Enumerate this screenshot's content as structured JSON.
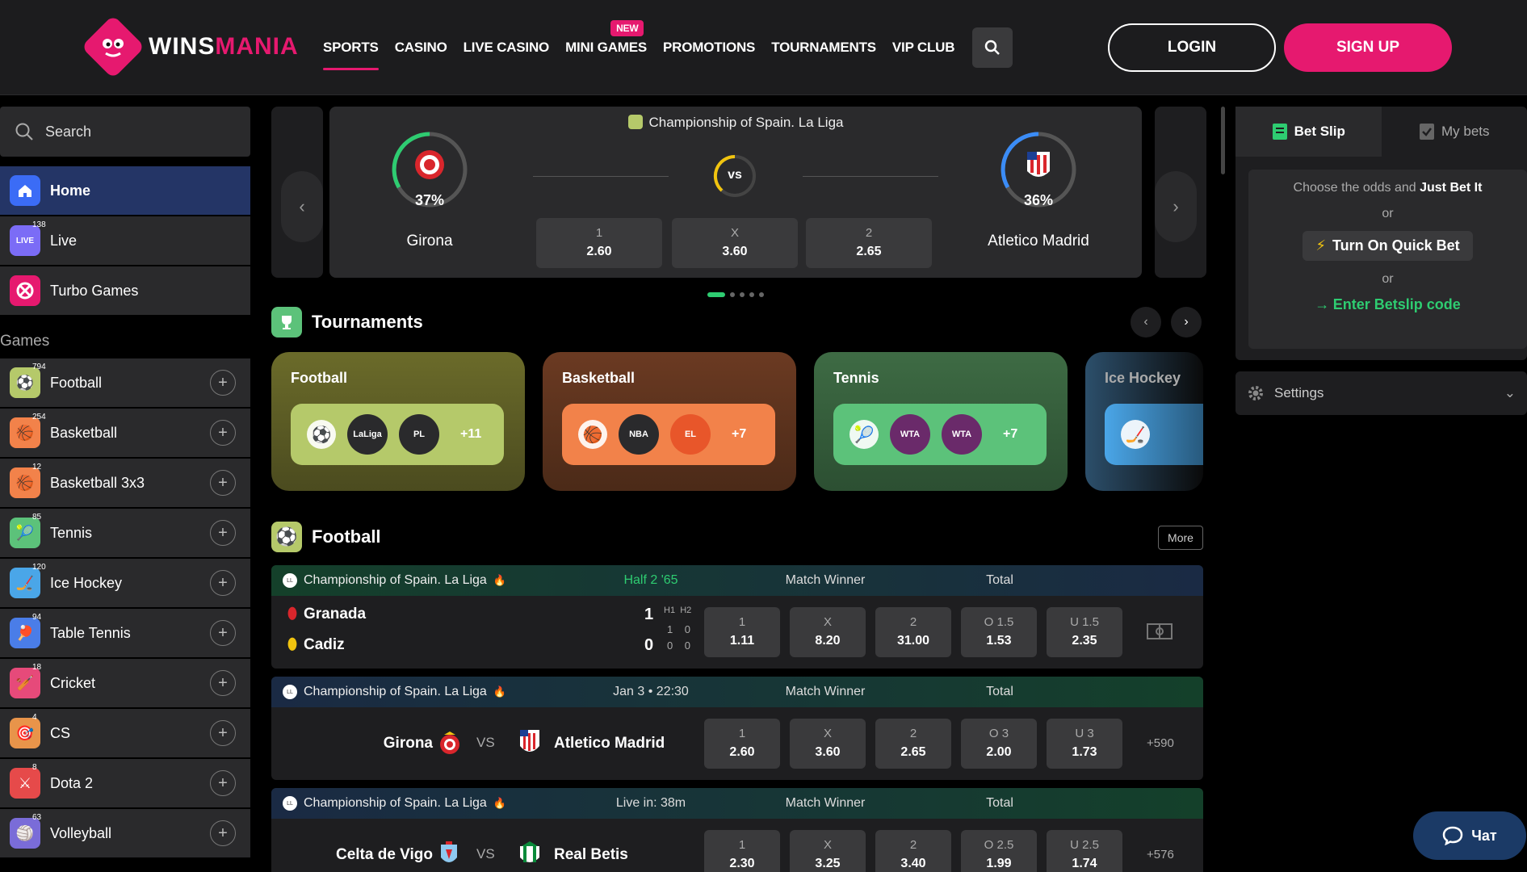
{
  "brand": {
    "name_part1": "WINS",
    "name_part2": "MANIA"
  },
  "nav": {
    "items": [
      {
        "label": "SPORTS"
      },
      {
        "label": "CASINO"
      },
      {
        "label": "LIVE CASINO"
      },
      {
        "label": "MINI GAMES"
      },
      {
        "label": "PROMOTIONS"
      },
      {
        "label": "TOURNAMENTS"
      },
      {
        "label": "VIP CLUB"
      }
    ],
    "new_badge": "NEW",
    "login": "LOGIN",
    "signup": "SIGN UP"
  },
  "sidebar": {
    "search_placeholder": "Search",
    "main": [
      {
        "label": "Home"
      },
      {
        "label": "Live",
        "count": "138"
      },
      {
        "label": "Turbo Games"
      }
    ],
    "section_title": "Games",
    "sports": [
      {
        "label": "Football",
        "count": "794"
      },
      {
        "label": "Basketball",
        "count": "254"
      },
      {
        "label": "Basketball 3x3",
        "count": "12"
      },
      {
        "label": "Tennis",
        "count": "85"
      },
      {
        "label": "Ice Hockey",
        "count": "120"
      },
      {
        "label": "Table Tennis",
        "count": "94"
      },
      {
        "label": "Cricket",
        "count": "18"
      },
      {
        "label": "CS",
        "count": "4"
      },
      {
        "label": "Dota 2",
        "count": "8"
      },
      {
        "label": "Volleyball",
        "count": "63"
      }
    ]
  },
  "featured": {
    "league": "Championship of Spain. La Liga",
    "home": {
      "name": "Girona",
      "pct": "37%"
    },
    "away": {
      "name": "Atletico Madrid",
      "pct": "36%"
    },
    "vs": "vs",
    "odds": [
      {
        "label": "1",
        "value": "2.60"
      },
      {
        "label": "X",
        "value": "3.60"
      },
      {
        "label": "2",
        "value": "2.65"
      }
    ]
  },
  "tournaments": {
    "title": "Tournaments",
    "cards": [
      {
        "title": "Football",
        "more": "+11",
        "badge1": "LaLiga",
        "badge2": "PL"
      },
      {
        "title": "Basketball",
        "more": "+7",
        "badge1": "NBA",
        "badge2": "EL"
      },
      {
        "title": "Tennis",
        "more": "+7",
        "badge1": "WTA",
        "badge2": "WTA"
      },
      {
        "title": "Ice Hockey",
        "more": "",
        "badge1": "",
        "badge2": ""
      }
    ]
  },
  "football": {
    "title": "Football",
    "more": "More",
    "events": [
      {
        "league": "Championship of Spain. La Liga",
        "status": "Half 2 '65",
        "market1": "Match Winner",
        "market2": "Total",
        "home": "Granada",
        "away": "Cadiz",
        "home_score": "1",
        "away_score": "0",
        "h1_label": "H1",
        "h2_label": "H2",
        "home_h1": "1",
        "home_h2": "0",
        "away_h1": "0",
        "away_h2": "0",
        "odds": [
          {
            "label": "1",
            "value": "1.11"
          },
          {
            "label": "X",
            "value": "8.20"
          },
          {
            "label": "2",
            "value": "31.00"
          },
          {
            "label": "O 1.5",
            "value": "1.53"
          },
          {
            "label": "U 1.5",
            "value": "2.35"
          }
        ]
      },
      {
        "league": "Championship of Spain. La Liga",
        "status": "Jan 3 • 22:30",
        "market1": "Match Winner",
        "market2": "Total",
        "home": "Girona",
        "away": "Atletico Madrid",
        "vs": "VS",
        "extra": "+590",
        "odds": [
          {
            "label": "1",
            "value": "2.60"
          },
          {
            "label": "X",
            "value": "3.60"
          },
          {
            "label": "2",
            "value": "2.65"
          },
          {
            "label": "O 3",
            "value": "2.00"
          },
          {
            "label": "U 3",
            "value": "1.73"
          }
        ]
      },
      {
        "league": "Championship of Spain. La Liga",
        "status": "Live in: 38m",
        "market1": "Match Winner",
        "market2": "Total",
        "home": "Celta de Vigo",
        "away": "Real Betis",
        "vs": "VS",
        "extra": "+576",
        "odds": [
          {
            "label": "1",
            "value": "2.30"
          },
          {
            "label": "X",
            "value": "3.25"
          },
          {
            "label": "2",
            "value": "3.40"
          },
          {
            "label": "O 2.5",
            "value": "1.99"
          },
          {
            "label": "U 2.5",
            "value": "1.74"
          }
        ]
      }
    ]
  },
  "betslip": {
    "tab_active": "Bet Slip",
    "tab_other": "My bets",
    "line1_prefix": "Choose the odds and",
    "line1_strong": "Just Bet It",
    "or1": "or",
    "quick_bet": "Turn On Quick Bet",
    "or2": "or",
    "code": "Enter Betslip code",
    "settings": "Settings"
  },
  "chat": {
    "label": "Чат"
  },
  "colors": {
    "accent": "#e6196f",
    "live_green": "#2ecc71",
    "active_nav": "#243566"
  }
}
